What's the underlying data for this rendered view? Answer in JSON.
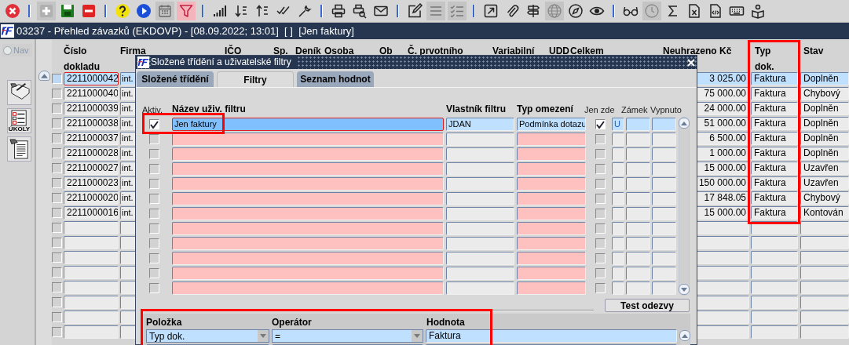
{
  "toolbar": {
    "groups": [
      [
        {
          "kind": "close",
          "disabled": false,
          "pressed": false
        }
      ],
      [
        {
          "kind": "add",
          "disabled": true,
          "pressed": false
        },
        {
          "kind": "save",
          "disabled": false,
          "pressed": false
        },
        {
          "kind": "delete",
          "disabled": false,
          "pressed": false
        }
      ],
      [
        {
          "kind": "help",
          "disabled": false,
          "pressed": false
        },
        {
          "kind": "play",
          "disabled": false,
          "pressed": false
        },
        {
          "kind": "calendar",
          "disabled": true,
          "pressed": false
        },
        {
          "kind": "filter",
          "disabled": false,
          "pressed": true
        }
      ],
      [
        {
          "kind": "signal",
          "disabled": false,
          "pressed": false
        },
        {
          "kind": "sort_down",
          "disabled": false,
          "pressed": false
        },
        {
          "kind": "sort_up",
          "disabled": false,
          "pressed": false
        },
        {
          "kind": "check",
          "disabled": false,
          "pressed": false
        },
        {
          "kind": "wrench",
          "disabled": false,
          "pressed": false
        }
      ],
      [
        {
          "kind": "print",
          "disabled": false,
          "pressed": false
        },
        {
          "kind": "preview",
          "disabled": false,
          "pressed": false
        },
        {
          "kind": "mail",
          "disabled": false,
          "pressed": false
        }
      ],
      [
        {
          "kind": "edit",
          "disabled": false,
          "pressed": false
        },
        {
          "kind": "list",
          "disabled": true,
          "pressed": false
        },
        {
          "kind": "checklist",
          "disabled": true,
          "pressed": false
        }
      ],
      [
        {
          "kind": "external",
          "disabled": false,
          "pressed": false
        },
        {
          "kind": "clip",
          "disabled": false,
          "pressed": false
        },
        {
          "kind": "signpost",
          "disabled": false,
          "pressed": false
        },
        {
          "kind": "globe",
          "disabled": true,
          "pressed": false
        },
        {
          "kind": "compass",
          "disabled": false,
          "pressed": false
        },
        {
          "kind": "eye",
          "disabled": false,
          "pressed": false
        }
      ],
      [
        {
          "kind": "glasses",
          "disabled": false,
          "pressed": false
        },
        {
          "kind": "clock",
          "disabled": true,
          "pressed": false
        },
        {
          "kind": "sum",
          "disabled": false,
          "pressed": false
        },
        {
          "kind": "xdoc",
          "disabled": false,
          "pressed": false
        },
        {
          "kind": "codedoc",
          "disabled": false,
          "pressed": false
        },
        {
          "kind": "keyboard",
          "disabled": false,
          "pressed": false
        },
        {
          "kind": "reader",
          "disabled": false,
          "pressed": false
        }
      ]
    ]
  },
  "window": {
    "title": "03237 - Přehled závazků (EKDOVP) - [08.09.2022; 13:01]  [ ]  [Jen faktury]"
  },
  "sidebar": {
    "nav": {
      "label": "Nav",
      "selected": false,
      "disabled": true
    },
    "buttons": [
      {
        "kind": "notes"
      },
      {
        "kind": "tasks",
        "label": "ÚKOLY"
      },
      {
        "kind": "document"
      }
    ]
  },
  "main_table": {
    "columns": [
      "Číslo dokladu",
      "Firma",
      "IČO",
      "Sp.",
      "Deník",
      "Osoba",
      "Ob",
      "Č. prvotního",
      "Variabilní",
      "UDD",
      "Celkem",
      "Neuhrazeno Kč",
      "Typ dok.",
      "Stav"
    ],
    "rows": [
      {
        "selected": true,
        "checked": false,
        "number": "2211000042",
        "company": "int.",
        "amount": "3 025.00",
        "type": "Faktura",
        "status": "Doplněn"
      },
      {
        "selected": false,
        "checked": false,
        "number": "2211000040",
        "company": "int.",
        "amount": "75 000.00",
        "type": "Faktura",
        "status": "Chybový"
      },
      {
        "selected": false,
        "checked": false,
        "number": "2211000039",
        "company": "int.",
        "amount": "24 000.00",
        "type": "Faktura",
        "status": "Doplněn"
      },
      {
        "selected": false,
        "checked": false,
        "number": "2211000038",
        "company": "int.",
        "amount": "51 000.00",
        "type": "Faktura",
        "status": "Doplněn"
      },
      {
        "selected": false,
        "checked": false,
        "number": "2211000037",
        "company": "int.",
        "amount": "6 500.00",
        "type": "Faktura",
        "status": "Doplněn"
      },
      {
        "selected": false,
        "checked": false,
        "number": "2211000028",
        "company": "int.",
        "amount": "1 000.00",
        "type": "Faktura",
        "status": "Doplněn"
      },
      {
        "selected": false,
        "checked": false,
        "number": "2211000027",
        "company": "int.",
        "amount": "15 000.00",
        "type": "Faktura",
        "status": "Uzavřen"
      },
      {
        "selected": false,
        "checked": false,
        "number": "2211000023",
        "company": "int.",
        "amount": "150 000.00",
        "type": "Faktura",
        "status": "Uzavřen"
      },
      {
        "selected": false,
        "checked": false,
        "number": "2211000020",
        "company": "int.",
        "amount": "17 848.05",
        "type": "Faktura",
        "status": "Chybový"
      },
      {
        "selected": false,
        "checked": false,
        "number": "2211000016",
        "company": "int.",
        "amount": "15 000.00",
        "type": "Faktura",
        "status": "Kontován"
      },
      {
        "selected": false,
        "checked": false
      },
      {
        "selected": false,
        "checked": false
      },
      {
        "selected": false,
        "checked": false
      },
      {
        "selected": false,
        "checked": false
      },
      {
        "selected": false,
        "checked": false
      },
      {
        "selected": false,
        "checked": false
      },
      {
        "selected": false,
        "checked": false
      },
      {
        "selected": false,
        "checked": false
      }
    ]
  },
  "dialog": {
    "title": "Složené třídění a uživatelské filtry",
    "tabs": [
      {
        "label": "Složené třídění",
        "selected": false
      },
      {
        "label": "Filtry",
        "selected": true
      },
      {
        "label": "Seznam hodnot",
        "selected": false
      }
    ],
    "filters": {
      "columns": [
        "Aktiv.",
        "Název uživ. filtru",
        "Vlastník filtru",
        "Typ omezení",
        "Jen zde",
        "Zámek",
        "Vypnuto"
      ],
      "rows": [
        {
          "selected": true,
          "active": true,
          "only_here": true,
          "name": "Jen faktury",
          "owner": "JDAN",
          "restriction": "Podmínka dotazu",
          "lock": "U"
        },
        {
          "selected": false,
          "active": false,
          "only_here": false
        },
        {
          "selected": false,
          "active": false,
          "only_here": false
        },
        {
          "selected": false,
          "active": false,
          "only_here": false
        },
        {
          "selected": false,
          "active": false,
          "only_here": false
        },
        {
          "selected": false,
          "active": false,
          "only_here": false
        },
        {
          "selected": false,
          "active": false,
          "only_here": false
        },
        {
          "selected": false,
          "active": false,
          "only_here": false
        },
        {
          "selected": false,
          "active": false,
          "only_here": false
        },
        {
          "selected": false,
          "active": false,
          "only_here": false
        },
        {
          "selected": false,
          "active": false,
          "only_here": false
        },
        {
          "selected": false,
          "active": false,
          "only_here": false
        }
      ]
    },
    "test_button": "Test odezvy",
    "conditions": {
      "columns": [
        "Položka",
        "Operátor",
        "Hodnota"
      ],
      "rows": [
        {
          "kind": "filled",
          "item": "Typ dok.",
          "operator": "=",
          "value": "Faktura"
        },
        {
          "kind": "empty"
        }
      ]
    }
  },
  "annotations": [
    {
      "kind": "column_frame"
    },
    {
      "kind": "filter_frame"
    },
    {
      "kind": "condition_frame"
    }
  ]
}
